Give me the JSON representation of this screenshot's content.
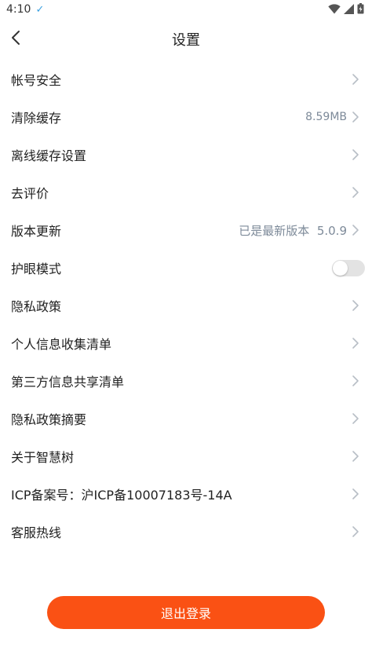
{
  "status_bar": {
    "time": "4:10",
    "check_icon": "check-icon",
    "icons": [
      "wifi-icon",
      "signal-icon",
      "battery-icon"
    ]
  },
  "header": {
    "title": "设置",
    "back_icon": "back-chevron-icon"
  },
  "settings": {
    "items": [
      {
        "label": "帐号安全",
        "value": ""
      },
      {
        "label": "清除缓存",
        "value": "8.59MB"
      },
      {
        "label": "离线缓存设置",
        "value": ""
      },
      {
        "label": "去评价",
        "value": ""
      },
      {
        "label": "版本更新",
        "value": "已是最新版本  5.0.9"
      },
      {
        "label": "护眼模式",
        "toggle": false
      },
      {
        "label": "隐私政策",
        "value": ""
      },
      {
        "label": "个人信息收集清单",
        "value": ""
      },
      {
        "label": "第三方信息共享清单",
        "value": ""
      },
      {
        "label": "隐私政策摘要",
        "value": ""
      },
      {
        "label": "关于智慧树",
        "value": ""
      },
      {
        "label": "ICP备案号：沪ICP备10007183号-14A",
        "value": ""
      },
      {
        "label": "客服热线",
        "value": ""
      }
    ]
  },
  "logout": {
    "label": "退出登录"
  },
  "colors": {
    "accent": "#fa5114",
    "chevron": "#b8bec6",
    "value_text": "#7d8a99"
  }
}
